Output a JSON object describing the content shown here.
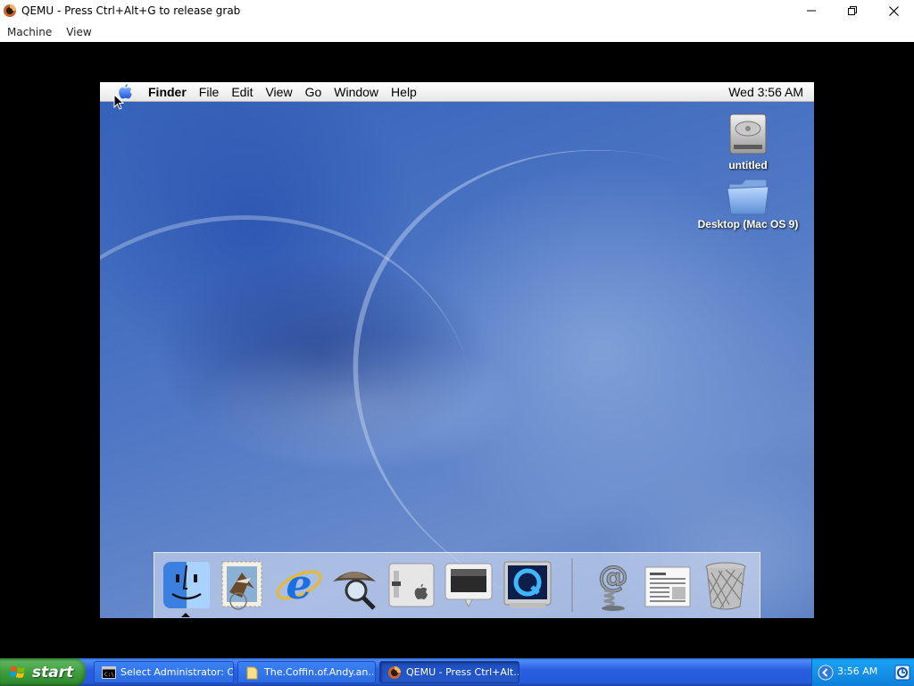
{
  "window": {
    "title": "QEMU - Press Ctrl+Alt+G to release grab",
    "menu": [
      "Machine",
      "View"
    ]
  },
  "mac": {
    "menus": [
      "Finder",
      "File",
      "Edit",
      "View",
      "Go",
      "Window",
      "Help"
    ],
    "clock": "Wed 3:56 AM",
    "desktop_icons": [
      {
        "label": "untitled",
        "icon": "hard-drive-icon"
      },
      {
        "label": "Desktop (Mac OS 9)",
        "icon": "folder-icon"
      }
    ],
    "dock": [
      "finder-icon",
      "mail-icon",
      "internet-explorer-icon",
      "sherlock-icon",
      "system-preferences-icon",
      "display-icon",
      "quicktime-icon",
      "mail-spring-icon",
      "text-document-icon",
      "trash-icon"
    ]
  },
  "taskbar": {
    "start_label": "start",
    "tasks": [
      {
        "label": "Select Administrator: C...",
        "icon": "console-icon"
      },
      {
        "label": "The.Coffin.of.Andy.an...",
        "icon": "folder-icon"
      },
      {
        "label": "QEMU - Press Ctrl+Alt...",
        "icon": "qemu-icon"
      }
    ],
    "clock": "3:56 AM"
  },
  "colors": {
    "xp_blue": "#245bd9",
    "start_green": "#3e9e3e",
    "tray_blue": "#1592e8"
  }
}
